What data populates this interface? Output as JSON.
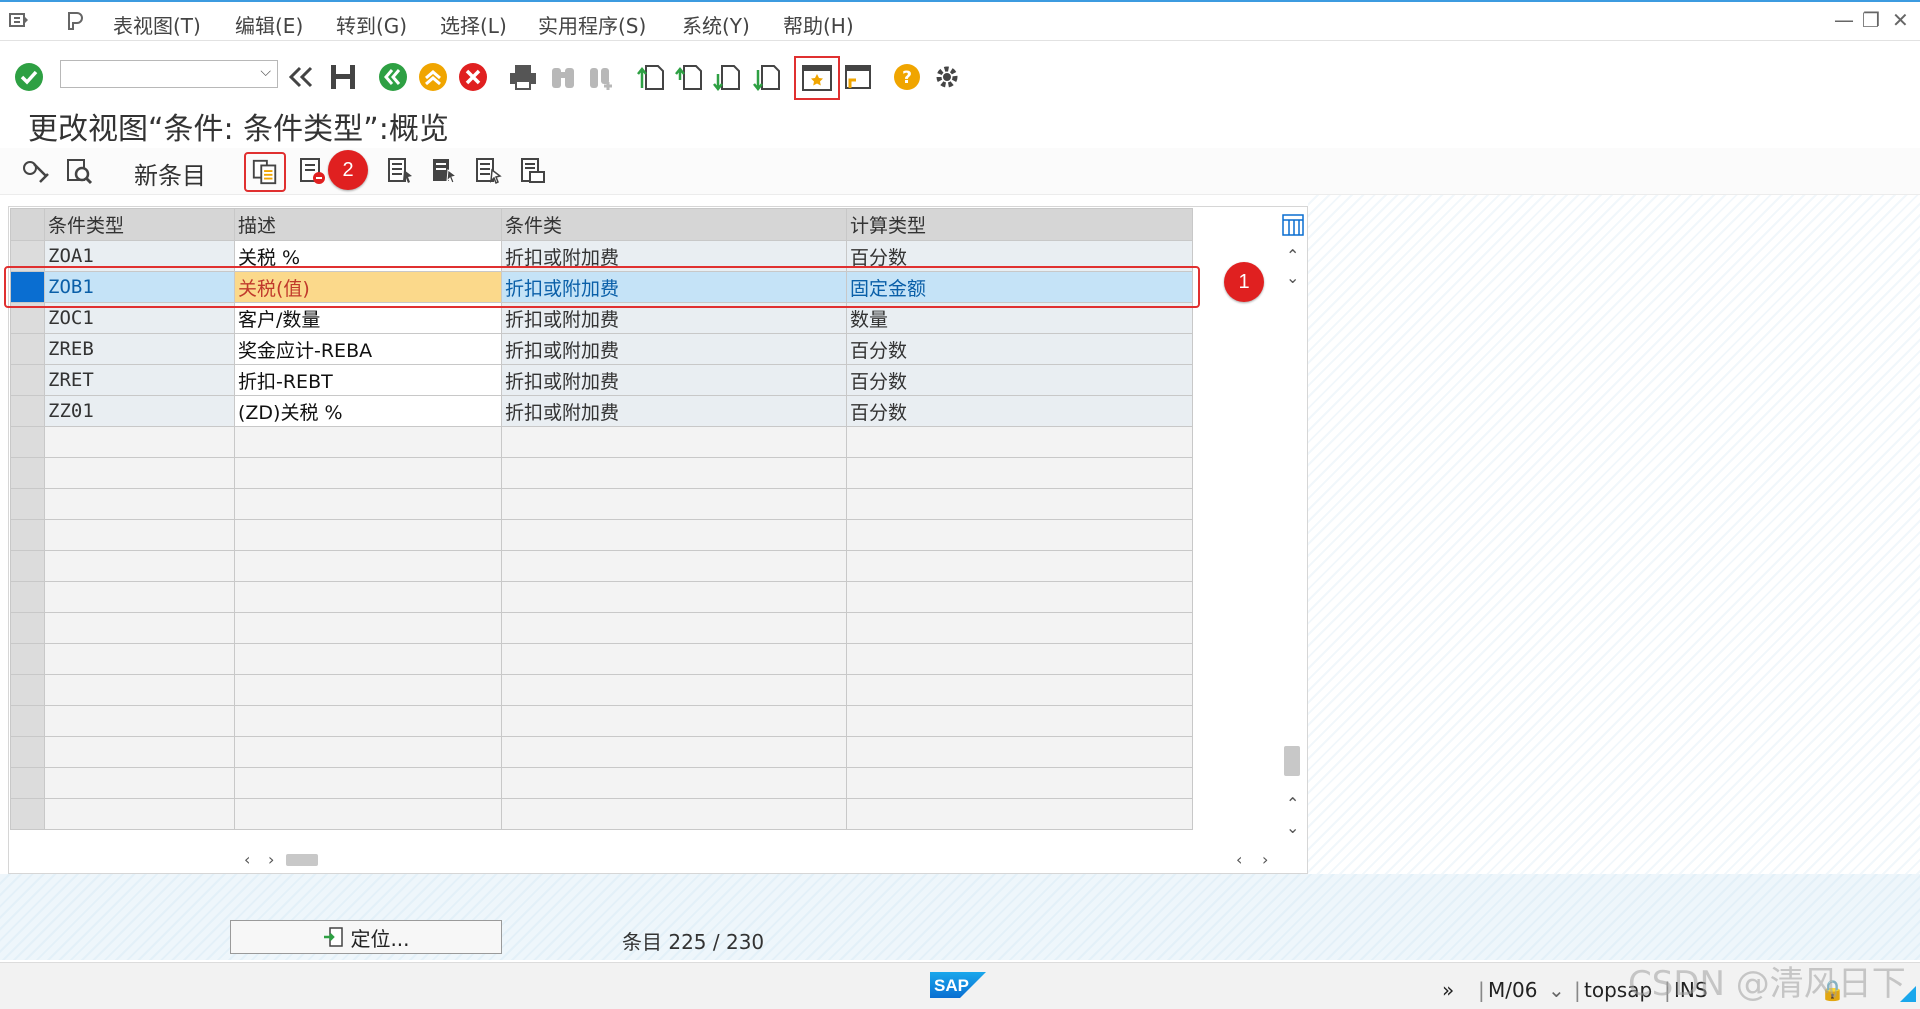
{
  "menu": {
    "items": [
      "表视图(T)",
      "编辑(E)",
      "转到(G)",
      "选择(L)",
      "实用程序(S)",
      "系统(Y)",
      "帮助(H)"
    ]
  },
  "toolbar": {
    "command_value": "",
    "icons": [
      "enter-check-icon",
      "back-icon",
      "save-icon",
      "green-back-icon",
      "exit-icon",
      "cancel-icon",
      "print-icon",
      "find-icon",
      "find-next-icon",
      "first-page-icon",
      "prev-page-icon",
      "next-page-icon",
      "last-page-icon",
      "create-session-icon",
      "shortcut-icon",
      "help-icon",
      "settings-icon"
    ]
  },
  "title": "更改视图“条件: 条件类型”:概览",
  "app_toolbar": {
    "new_entries": "新条目"
  },
  "table": {
    "headers": [
      "条件类型",
      "描述",
      "条件类",
      "计算类型"
    ],
    "rows": [
      {
        "type": "ZOA1",
        "desc": "关税 %",
        "cls": "折扣或附加费",
        "calc": "百分数"
      },
      {
        "type": "ZOB1",
        "desc": "关税(值)",
        "cls": "折扣或附加费",
        "calc": "固定金额"
      },
      {
        "type": "ZOC1",
        "desc": "客户/数量",
        "cls": "折扣或附加费",
        "calc": "数量"
      },
      {
        "type": "ZREB",
        "desc": "奖金应计-REBA",
        "cls": "折扣或附加费",
        "calc": "百分数"
      },
      {
        "type": "ZRET",
        "desc": "折扣-REBT",
        "cls": "折扣或附加费",
        "calc": "百分数"
      },
      {
        "type": "ZZ01",
        "desc": "(ZD)关税 %",
        "cls": "折扣或附加费",
        "calc": "百分数"
      }
    ],
    "selected_row": "ZOB1"
  },
  "annotations": {
    "badge1": "1",
    "badge2": "2"
  },
  "bottom": {
    "position_button": "定位...",
    "entries_label": "条目 225 / 230"
  },
  "statusbar": {
    "logo": "SAP",
    "session": "M/06",
    "server": "topsap",
    "mode": "INS",
    "watermark": "CSDN @清风日下"
  },
  "colors": {
    "accent": "#0a6ed1",
    "highlight_row": "#c5e3f7",
    "highlight_desc": "#fbd98b",
    "annotation": "#e03030"
  }
}
